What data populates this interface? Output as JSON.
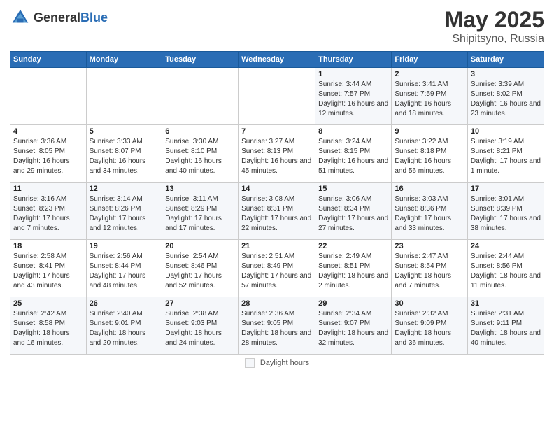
{
  "header": {
    "logo_general": "General",
    "logo_blue": "Blue",
    "title": "May 2025",
    "location": "Shipitsyno, Russia"
  },
  "footer": {
    "daylight_label": "Daylight hours"
  },
  "weekdays": [
    "Sunday",
    "Monday",
    "Tuesday",
    "Wednesday",
    "Thursday",
    "Friday",
    "Saturday"
  ],
  "weeks": [
    {
      "days": [
        {
          "num": "",
          "detail": ""
        },
        {
          "num": "",
          "detail": ""
        },
        {
          "num": "",
          "detail": ""
        },
        {
          "num": "",
          "detail": ""
        },
        {
          "num": "1",
          "detail": "Sunrise: 3:44 AM\nSunset: 7:57 PM\nDaylight: 16 hours\nand 12 minutes."
        },
        {
          "num": "2",
          "detail": "Sunrise: 3:41 AM\nSunset: 7:59 PM\nDaylight: 16 hours\nand 18 minutes."
        },
        {
          "num": "3",
          "detail": "Sunrise: 3:39 AM\nSunset: 8:02 PM\nDaylight: 16 hours\nand 23 minutes."
        }
      ]
    },
    {
      "days": [
        {
          "num": "4",
          "detail": "Sunrise: 3:36 AM\nSunset: 8:05 PM\nDaylight: 16 hours\nand 29 minutes."
        },
        {
          "num": "5",
          "detail": "Sunrise: 3:33 AM\nSunset: 8:07 PM\nDaylight: 16 hours\nand 34 minutes."
        },
        {
          "num": "6",
          "detail": "Sunrise: 3:30 AM\nSunset: 8:10 PM\nDaylight: 16 hours\nand 40 minutes."
        },
        {
          "num": "7",
          "detail": "Sunrise: 3:27 AM\nSunset: 8:13 PM\nDaylight: 16 hours\nand 45 minutes."
        },
        {
          "num": "8",
          "detail": "Sunrise: 3:24 AM\nSunset: 8:15 PM\nDaylight: 16 hours\nand 51 minutes."
        },
        {
          "num": "9",
          "detail": "Sunrise: 3:22 AM\nSunset: 8:18 PM\nDaylight: 16 hours\nand 56 minutes."
        },
        {
          "num": "10",
          "detail": "Sunrise: 3:19 AM\nSunset: 8:21 PM\nDaylight: 17 hours\nand 1 minute."
        }
      ]
    },
    {
      "days": [
        {
          "num": "11",
          "detail": "Sunrise: 3:16 AM\nSunset: 8:23 PM\nDaylight: 17 hours\nand 7 minutes."
        },
        {
          "num": "12",
          "detail": "Sunrise: 3:14 AM\nSunset: 8:26 PM\nDaylight: 17 hours\nand 12 minutes."
        },
        {
          "num": "13",
          "detail": "Sunrise: 3:11 AM\nSunset: 8:29 PM\nDaylight: 17 hours\nand 17 minutes."
        },
        {
          "num": "14",
          "detail": "Sunrise: 3:08 AM\nSunset: 8:31 PM\nDaylight: 17 hours\nand 22 minutes."
        },
        {
          "num": "15",
          "detail": "Sunrise: 3:06 AM\nSunset: 8:34 PM\nDaylight: 17 hours\nand 27 minutes."
        },
        {
          "num": "16",
          "detail": "Sunrise: 3:03 AM\nSunset: 8:36 PM\nDaylight: 17 hours\nand 33 minutes."
        },
        {
          "num": "17",
          "detail": "Sunrise: 3:01 AM\nSunset: 8:39 PM\nDaylight: 17 hours\nand 38 minutes."
        }
      ]
    },
    {
      "days": [
        {
          "num": "18",
          "detail": "Sunrise: 2:58 AM\nSunset: 8:41 PM\nDaylight: 17 hours\nand 43 minutes."
        },
        {
          "num": "19",
          "detail": "Sunrise: 2:56 AM\nSunset: 8:44 PM\nDaylight: 17 hours\nand 48 minutes."
        },
        {
          "num": "20",
          "detail": "Sunrise: 2:54 AM\nSunset: 8:46 PM\nDaylight: 17 hours\nand 52 minutes."
        },
        {
          "num": "21",
          "detail": "Sunrise: 2:51 AM\nSunset: 8:49 PM\nDaylight: 17 hours\nand 57 minutes."
        },
        {
          "num": "22",
          "detail": "Sunrise: 2:49 AM\nSunset: 8:51 PM\nDaylight: 18 hours\nand 2 minutes."
        },
        {
          "num": "23",
          "detail": "Sunrise: 2:47 AM\nSunset: 8:54 PM\nDaylight: 18 hours\nand 7 minutes."
        },
        {
          "num": "24",
          "detail": "Sunrise: 2:44 AM\nSunset: 8:56 PM\nDaylight: 18 hours\nand 11 minutes."
        }
      ]
    },
    {
      "days": [
        {
          "num": "25",
          "detail": "Sunrise: 2:42 AM\nSunset: 8:58 PM\nDaylight: 18 hours\nand 16 minutes."
        },
        {
          "num": "26",
          "detail": "Sunrise: 2:40 AM\nSunset: 9:01 PM\nDaylight: 18 hours\nand 20 minutes."
        },
        {
          "num": "27",
          "detail": "Sunrise: 2:38 AM\nSunset: 9:03 PM\nDaylight: 18 hours\nand 24 minutes."
        },
        {
          "num": "28",
          "detail": "Sunrise: 2:36 AM\nSunset: 9:05 PM\nDaylight: 18 hours\nand 28 minutes."
        },
        {
          "num": "29",
          "detail": "Sunrise: 2:34 AM\nSunset: 9:07 PM\nDaylight: 18 hours\nand 32 minutes."
        },
        {
          "num": "30",
          "detail": "Sunrise: 2:32 AM\nSunset: 9:09 PM\nDaylight: 18 hours\nand 36 minutes."
        },
        {
          "num": "31",
          "detail": "Sunrise: 2:31 AM\nSunset: 9:11 PM\nDaylight: 18 hours\nand 40 minutes."
        }
      ]
    }
  ]
}
